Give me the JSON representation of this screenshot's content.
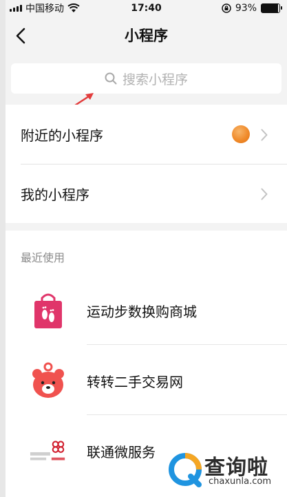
{
  "status_bar": {
    "carrier": "中国移动",
    "time": "17:40",
    "battery": "93%",
    "battery_level": 0.93
  },
  "nav": {
    "title": "小程序",
    "back_icon": "chevron-left-icon"
  },
  "search": {
    "placeholder": "搜索小程序",
    "icon": "search-icon"
  },
  "menu": {
    "items": [
      {
        "label": "附近的小程序",
        "thumb": true
      },
      {
        "label": "我的小程序",
        "thumb": false
      }
    ]
  },
  "recent": {
    "header": "最近使用",
    "apps": [
      {
        "name": "运动步数换购商城",
        "icon": "shopping-bag-footprint-icon"
      },
      {
        "name": "转转二手交易网",
        "icon": "bear-face-icon"
      },
      {
        "name": "联通微服务",
        "icon": "china-unicom-logo-icon"
      }
    ]
  },
  "watermark": {
    "title": "查询啦",
    "url": "chaxunla.com"
  },
  "colors": {
    "accent_red": "#e23c3c",
    "bag_pink": "#e0356a",
    "bear_red": "#f0524f",
    "separator": "#e3e3e3",
    "placeholder_gray": "#b2b2b2"
  }
}
